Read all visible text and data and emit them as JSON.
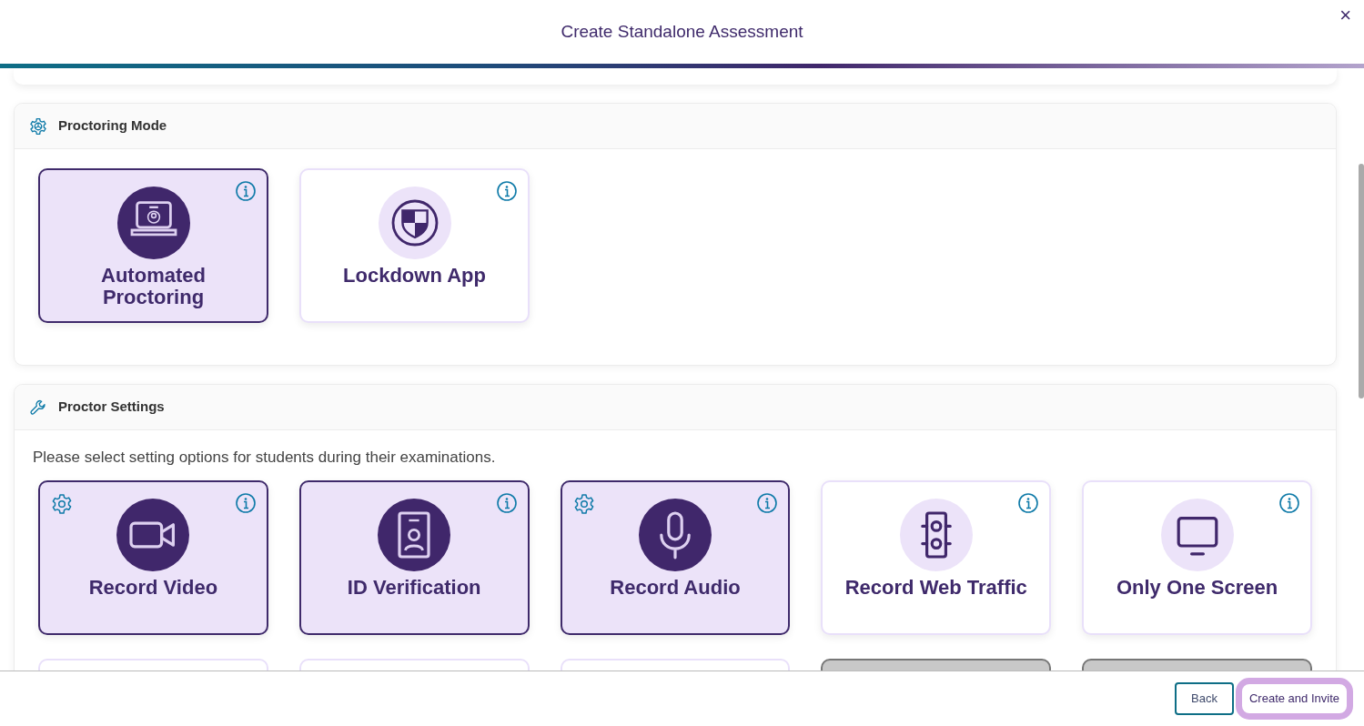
{
  "dialog": {
    "title": "Create Standalone Assessment",
    "close": "×"
  },
  "proctoring_mode": {
    "title": "Proctoring Mode",
    "options": [
      {
        "label": "Automated Proctoring",
        "kind": "laptop",
        "selected": true,
        "settings": false
      },
      {
        "label": "Lockdown App",
        "kind": "shield",
        "selected": false,
        "settings": false
      }
    ]
  },
  "proctor_settings": {
    "title": "Proctor Settings",
    "description": "Please select setting options for students during their examinations.",
    "options": [
      {
        "label": "Record Video",
        "kind": "video",
        "selected": true,
        "settings": true
      },
      {
        "label": "ID Verification",
        "kind": "id",
        "selected": true,
        "settings": false
      },
      {
        "label": "Record Audio",
        "kind": "mic",
        "selected": true,
        "settings": true
      },
      {
        "label": "Record Web Traffic",
        "kind": "traffic",
        "selected": false,
        "settings": false
      },
      {
        "label": "Only One Screen",
        "kind": "monitor",
        "selected": false,
        "settings": false
      }
    ],
    "next_row": [
      {
        "disabled": false
      },
      {
        "disabled": false
      },
      {
        "disabled": false
      },
      {
        "disabled": true
      },
      {
        "disabled": true
      }
    ]
  },
  "footer": {
    "buttons": [
      {
        "label": "Back",
        "kind": "outline"
      },
      {
        "label": "Create and Invite",
        "kind": "primary"
      }
    ]
  }
}
